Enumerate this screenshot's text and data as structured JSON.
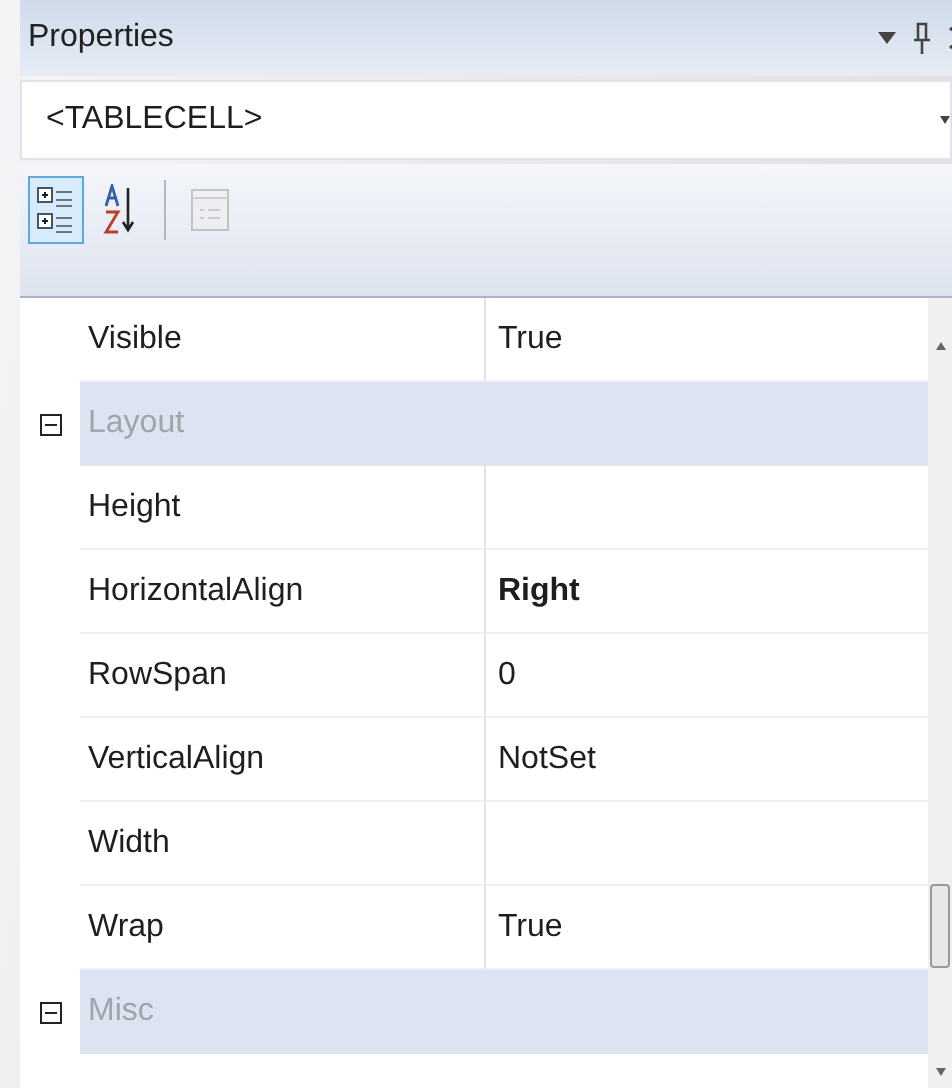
{
  "window": {
    "title": "Properties"
  },
  "object_selector": {
    "value": "<TABLECELL>"
  },
  "toolbar": [
    {
      "kind": "categorized",
      "selected": true,
      "disabled": false
    },
    {
      "kind": "alphabetical",
      "selected": false,
      "disabled": false
    },
    {
      "kind": "property_pages",
      "selected": false,
      "disabled": true
    }
  ],
  "grid": [
    {
      "kind": "property",
      "name": "Visible",
      "value": "True",
      "modified": false
    },
    {
      "kind": "category",
      "name": "Layout",
      "expanded": true
    },
    {
      "kind": "property",
      "name": "Height"
    },
    {
      "kind": "property",
      "name": "HorizontalAlign",
      "value": "Right",
      "modified": true
    },
    {
      "kind": "property",
      "name": "RowSpan",
      "value": "0",
      "modified": false
    },
    {
      "kind": "property",
      "name": "VerticalAlign",
      "value": "NotSet",
      "modified": false
    },
    {
      "kind": "property",
      "name": "Width"
    },
    {
      "kind": "property",
      "name": "Wrap",
      "value": "True",
      "modified": false
    },
    {
      "kind": "category",
      "name": "Misc",
      "expanded": true
    }
  ]
}
